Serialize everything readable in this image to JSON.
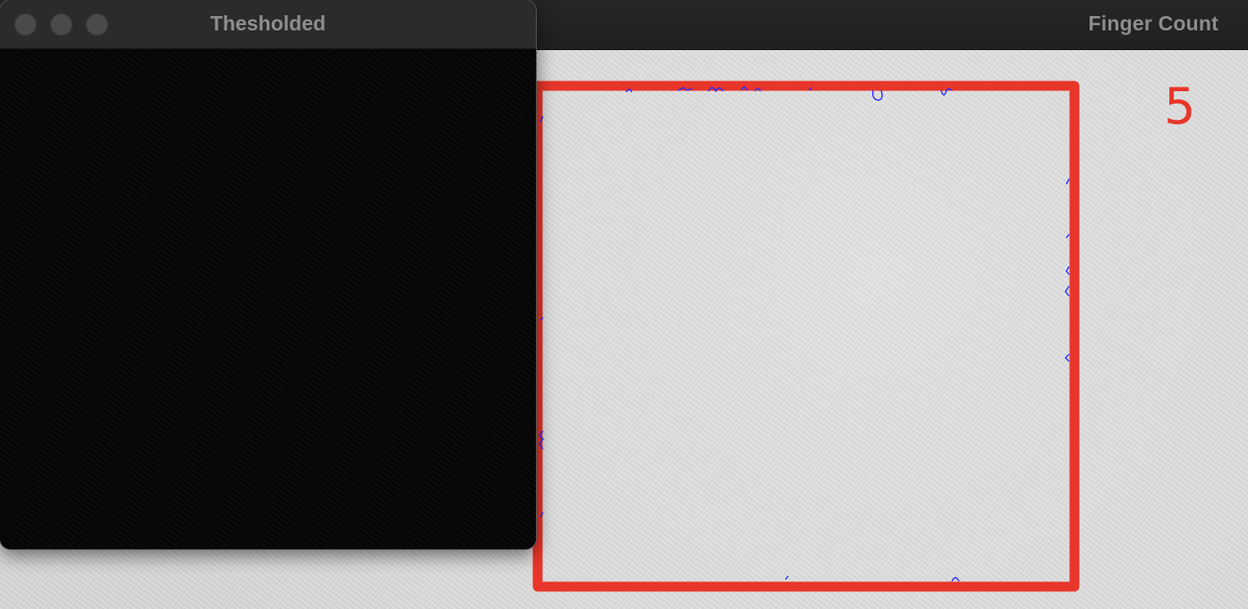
{
  "finger_count_window": {
    "title": "Finger Count",
    "count_text": "5",
    "roi_color": "#e8362a",
    "contour_color": "#2a2aff"
  },
  "threshold_window": {
    "title": "Thesholded",
    "controls": {
      "close_icon": "traffic-light-close",
      "minimize_icon": "traffic-light-minimize",
      "maximize_icon": "traffic-light-maximize"
    }
  }
}
